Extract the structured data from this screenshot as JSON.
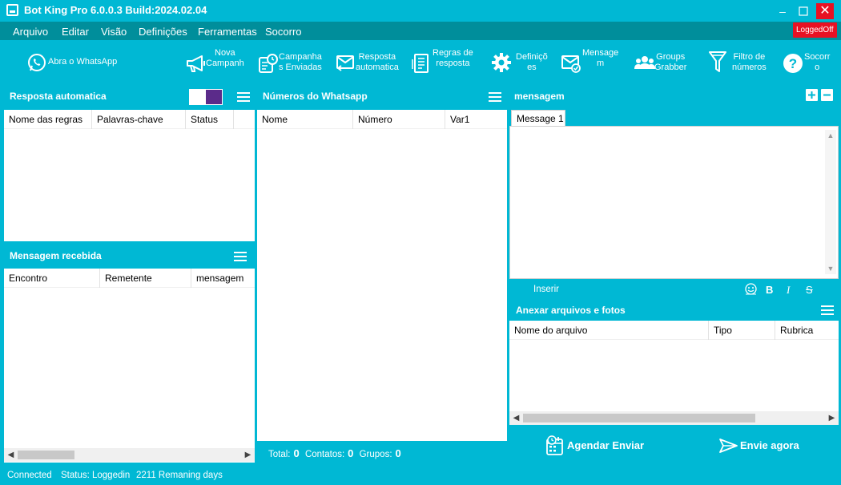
{
  "window": {
    "title": "Bot King Pro 6.0.0.3 Build:2024.02.04",
    "min_glyph": "–",
    "max_glyph": "☐",
    "close_glyph": "✕"
  },
  "menu": {
    "items": [
      "Arquivo",
      "Editar",
      "Visão",
      "Definições",
      "Ferramentas",
      "Socorro"
    ],
    "status_badge": "LoggedOff",
    "status_badge_color": "#e81123"
  },
  "toolbar": {
    "open_whatsapp": "Abra o WhatsApp",
    "new_campaign": "Nova\nCampanh",
    "sent_campaigns": "Campanha\ns Enviadas",
    "auto_reply": "Resposta\nautomatica",
    "reply_rules": "Regras de\nresposta",
    "settings": "Definiçõ\nes",
    "message": "Mensage\nm",
    "groups_grabber": "Groups\nGrabber",
    "number_filter": "Filtro de\nnúmeros",
    "help": "Socorr\no"
  },
  "auto_reply_panel": {
    "title": "Resposta automatica",
    "columns": [
      "Nome das regras",
      "Palavras-chave",
      "Status"
    ]
  },
  "received_panel": {
    "title": "Mensagem recebida",
    "columns": [
      "Encontro",
      "Remetente",
      "mensagem"
    ]
  },
  "numbers_panel": {
    "title": "Números do Whatsapp",
    "columns": [
      "Nome",
      "Número",
      "Var1"
    ],
    "total_label": "Total:",
    "total_value": "0",
    "contacts_label": "Contatos:",
    "contacts_value": "0",
    "groups_label": "Grupos:",
    "groups_value": "0"
  },
  "message_panel": {
    "title": "mensagem",
    "tab": "Message 1",
    "insert_label": "Inserir",
    "bold": "B",
    "italic": "I",
    "strike": "S"
  },
  "attachments_panel": {
    "title": "Anexar arquivos e fotos",
    "columns": [
      "Nome do arquivo",
      "Tipo",
      "Rubrica"
    ]
  },
  "actions": {
    "schedule_send": "Agendar Enviar",
    "send_now": "Envie agora"
  },
  "statusbar": {
    "connection": "Connected",
    "status": "Status: Loggedin",
    "remaining": "2211 Remaning days"
  },
  "colors": {
    "accent": "#00b8d4",
    "menubar": "#008e9b",
    "toggle_purple": "#5b2b8a",
    "close_red": "#e81123"
  }
}
